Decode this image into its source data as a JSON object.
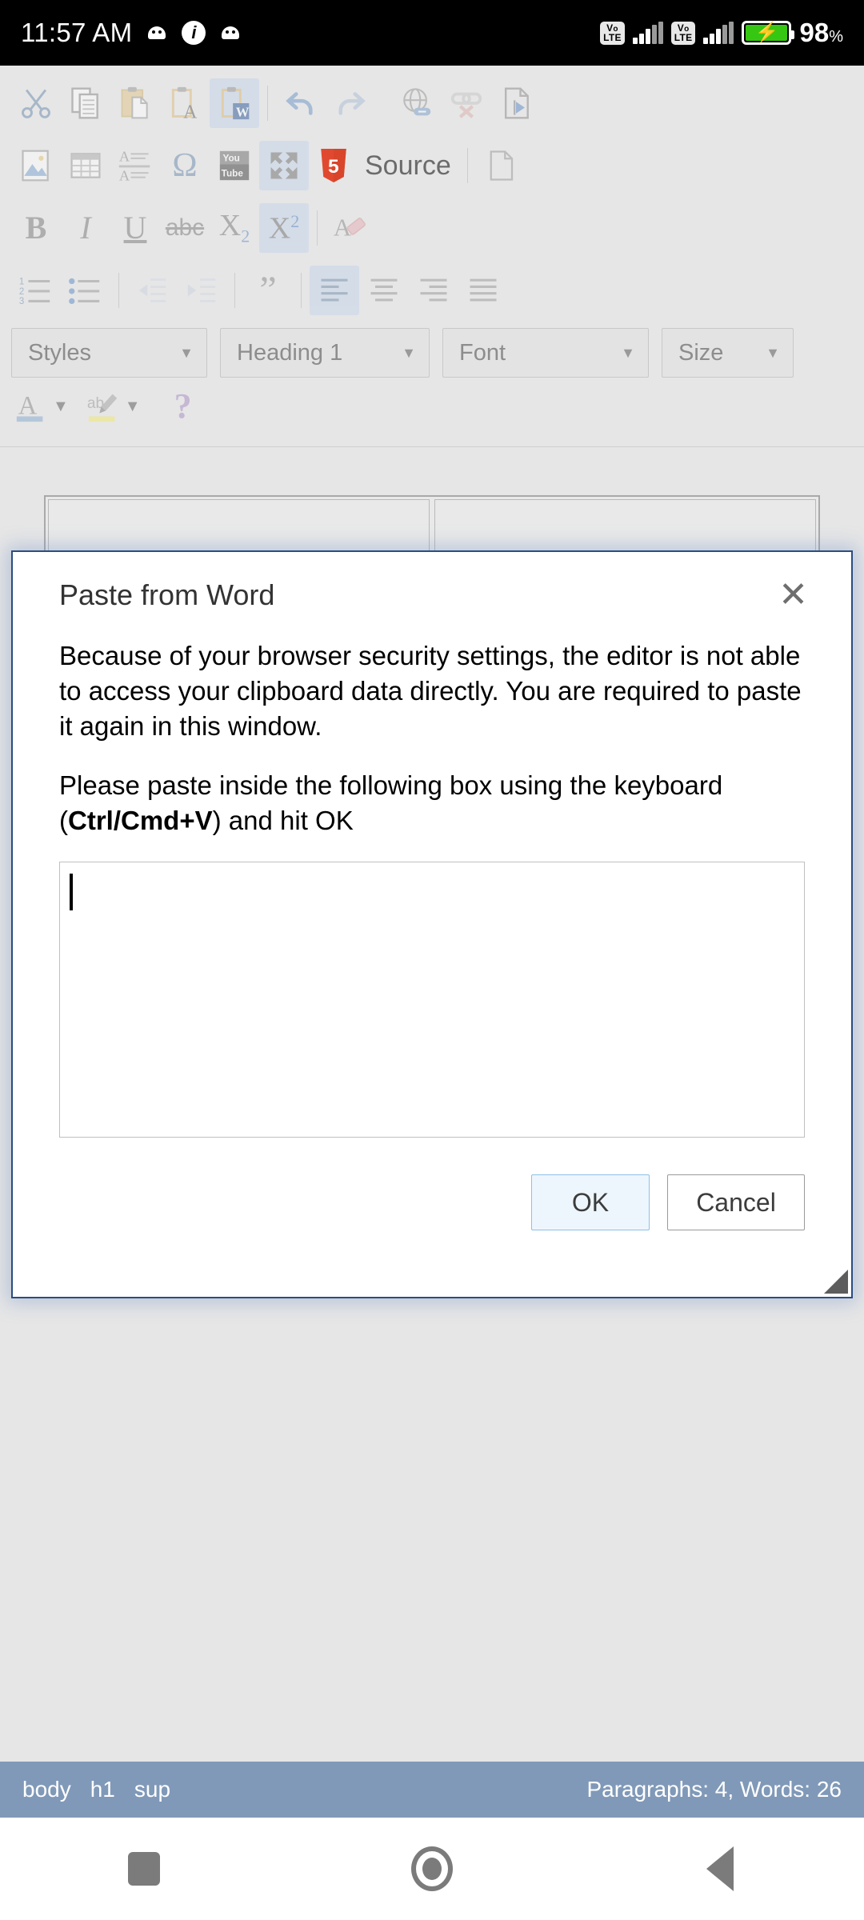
{
  "statusbar": {
    "time": "11:57 AM",
    "icons": [
      "android-icon",
      "inbox-icon",
      "android-icon"
    ],
    "sim1_network": "VoLTE",
    "sim2_network": "VoLTE",
    "battery_percent": "98",
    "battery_percent_symbol": "%",
    "battery_state": "charging"
  },
  "toolbar": {
    "row1": [
      {
        "name": "cut",
        "label": "Cut",
        "state": "normal"
      },
      {
        "name": "copy",
        "label": "Copy",
        "state": "normal"
      },
      {
        "name": "paste",
        "label": "Paste",
        "state": "normal"
      },
      {
        "name": "paste-as-plain-text",
        "label": "Paste as plain text",
        "state": "normal"
      },
      {
        "name": "paste-from-word",
        "label": "Paste from Word",
        "state": "active"
      },
      {
        "name": "undo",
        "label": "Undo",
        "state": "normal"
      },
      {
        "name": "redo",
        "label": "Redo",
        "state": "disabled"
      },
      {
        "name": "link",
        "label": "Link",
        "state": "normal"
      },
      {
        "name": "unlink",
        "label": "Unlink",
        "state": "disabled"
      },
      {
        "name": "anchor",
        "label": "Anchor",
        "state": "normal"
      }
    ],
    "row2": [
      {
        "name": "image",
        "label": "Image",
        "state": "normal"
      },
      {
        "name": "table",
        "label": "Table",
        "state": "normal"
      },
      {
        "name": "horizontal-rule",
        "label": "Horizontal Line",
        "state": "normal"
      },
      {
        "name": "special-character",
        "label": "Insert Special Character",
        "state": "normal"
      },
      {
        "name": "youtube",
        "label": "YouTube",
        "state": "normal"
      },
      {
        "name": "maximize",
        "label": "Maximize",
        "state": "active"
      },
      {
        "name": "source",
        "label": "Source",
        "state": "normal"
      },
      {
        "name": "new-page",
        "label": "New Page",
        "state": "normal"
      }
    ],
    "source_label": "Source",
    "row3": [
      {
        "name": "bold",
        "label": "B",
        "state": "normal"
      },
      {
        "name": "italic",
        "label": "I",
        "state": "normal"
      },
      {
        "name": "underline",
        "label": "U",
        "state": "normal"
      },
      {
        "name": "strikethrough",
        "label": "abc",
        "state": "normal"
      },
      {
        "name": "subscript",
        "label": "X",
        "sub": "2",
        "state": "normal"
      },
      {
        "name": "superscript",
        "label": "X",
        "sup": "2",
        "state": "active"
      },
      {
        "name": "remove-format",
        "label": "Remove Format",
        "state": "normal"
      }
    ],
    "row4": [
      {
        "name": "numbered-list",
        "label": "Insert/Remove Numbered List",
        "state": "normal"
      },
      {
        "name": "bulleted-list",
        "label": "Insert/Remove Bulleted List",
        "state": "normal"
      },
      {
        "name": "outdent",
        "label": "Decrease Indent",
        "state": "disabled"
      },
      {
        "name": "indent",
        "label": "Increase Indent",
        "state": "disabled"
      },
      {
        "name": "blockquote",
        "label": "Block Quote",
        "state": "normal"
      },
      {
        "name": "align-left",
        "label": "Align Left",
        "state": "active"
      },
      {
        "name": "align-center",
        "label": "Center",
        "state": "normal"
      },
      {
        "name": "align-right",
        "label": "Align Right",
        "state": "normal"
      },
      {
        "name": "justify",
        "label": "Justify",
        "state": "normal"
      }
    ],
    "row6": [
      {
        "name": "text-color",
        "label": "Text Color",
        "state": "normal"
      },
      {
        "name": "background-color",
        "label": "Background Color",
        "state": "normal"
      },
      {
        "name": "about",
        "label": "?",
        "state": "normal"
      }
    ],
    "dropdowns": [
      {
        "name": "styles",
        "value": "Styles"
      },
      {
        "name": "paragraph-format",
        "value": "Heading 1"
      },
      {
        "name": "font",
        "value": "Font"
      },
      {
        "name": "font-size",
        "value": "Size"
      }
    ],
    "caret": "▼"
  },
  "dialog": {
    "title": "Paste from Word",
    "close_glyph": "✕",
    "paragraph1": "Because of your browser security settings, the editor is not able to access your clipboard data directly. You are required to paste it again in this window.",
    "paragraph2_before": "Please paste inside the following box using the keyboard (",
    "paragraph2_bold": "Ctrl/Cmd+V",
    "paragraph2_after": ") and hit OK",
    "textarea_value": "",
    "ok_label": "OK",
    "cancel_label": "Cancel"
  },
  "elements_path": {
    "items": [
      "body",
      "h1",
      "sup"
    ],
    "word_count": "Paragraphs: 4, Words: 26"
  },
  "navbar": {
    "recents": "recents-square-icon",
    "home": "home-circle-icon",
    "back": "back-triangle-icon"
  },
  "colors": {
    "accent": "#2a4e80",
    "toolbar_bg": "#e6e6e6",
    "statusbar_path_bg": "#8099b8",
    "active_btn_bg": "#c3d4ea",
    "battery_green": "#36c712"
  }
}
